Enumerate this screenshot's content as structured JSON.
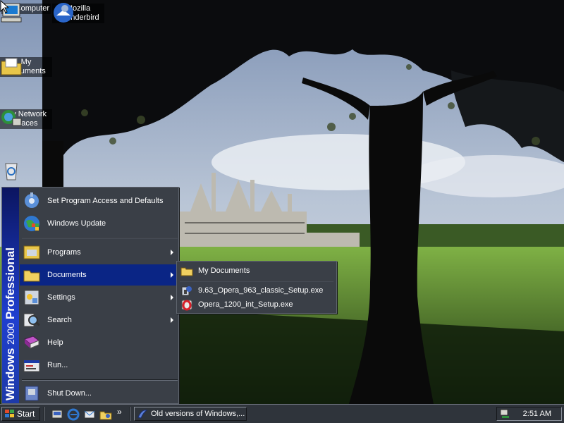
{
  "desktop": {
    "icons": [
      {
        "label": "My Computer",
        "icon": "my-computer-icon"
      },
      {
        "label": "Mozilla Thunderbird",
        "icon": "thunderbird-icon"
      },
      {
        "label": "My Documents",
        "icon": "my-documents-icon"
      },
      {
        "label": "My Network Places",
        "icon": "network-places-icon"
      },
      {
        "label": "",
        "icon": "recycle-bin-icon"
      }
    ]
  },
  "start_menu": {
    "banner_brand": "Windows",
    "banner_version": "2000",
    "banner_edition": "Professional",
    "items": [
      {
        "label": "Set Program Access and Defaults",
        "icon": "program-access-icon",
        "submenu": false
      },
      {
        "label": "Windows Update",
        "icon": "windows-update-icon",
        "submenu": false
      },
      {
        "label": "Programs",
        "icon": "programs-icon",
        "submenu": true
      },
      {
        "label": "Documents",
        "icon": "documents-folder-icon",
        "submenu": true,
        "highlighted": true
      },
      {
        "label": "Settings",
        "icon": "settings-icon",
        "submenu": true
      },
      {
        "label": "Search",
        "icon": "search-icon",
        "submenu": true
      },
      {
        "label": "Help",
        "icon": "help-book-icon",
        "submenu": false
      },
      {
        "label": "Run...",
        "icon": "run-icon",
        "submenu": false
      },
      {
        "label": "Shut Down...",
        "icon": "shut-down-icon",
        "submenu": false
      }
    ]
  },
  "documents_submenu": {
    "items": [
      {
        "label": "My Documents",
        "icon": "folder-icon"
      },
      {
        "label": "9.63_Opera_963_classic_Setup.exe",
        "icon": "setup-exe-icon"
      },
      {
        "label": "Opera_1200_int_Setup.exe",
        "icon": "opera-icon"
      }
    ]
  },
  "taskbar": {
    "start_label": "Start",
    "quick_launch": [
      "show-desktop-icon",
      "internet-explorer-icon",
      "outlook-express-icon",
      "windows-explorer-icon"
    ],
    "overflow": "»",
    "task_button_label": "Old versions of Windows,...",
    "clock": "2:51 AM"
  },
  "colors": {
    "menu_bg": "#3a3f47",
    "highlight": "#0a2585",
    "taskbar_bg": "#2f343b",
    "banner": "#1f3fd0"
  }
}
